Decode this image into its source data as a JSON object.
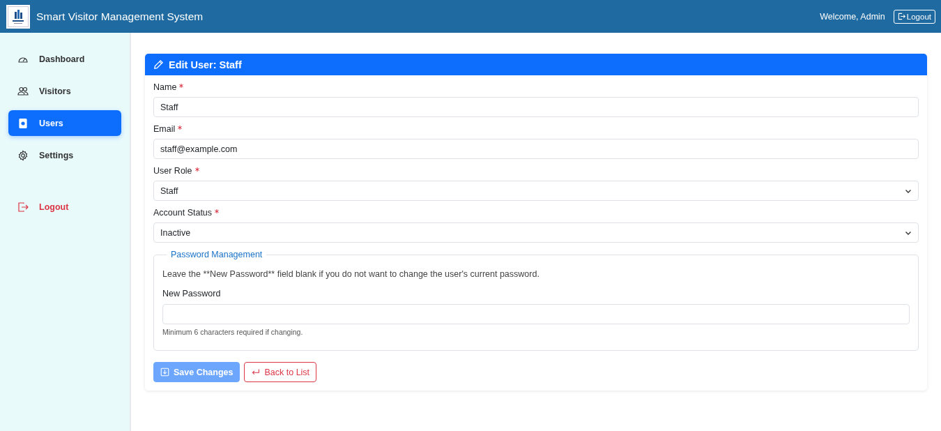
{
  "header": {
    "title": "Smart Visitor Management System",
    "welcome": "Welcome, Admin",
    "logout_button": "Logout"
  },
  "sidebar": {
    "items": [
      {
        "label": "Dashboard",
        "selected": false,
        "kind": "nav"
      },
      {
        "label": "Visitors",
        "selected": false,
        "kind": "nav"
      },
      {
        "label": "Users",
        "selected": true,
        "kind": "nav"
      },
      {
        "label": "Settings",
        "selected": false,
        "kind": "nav"
      },
      {
        "label": "Logout",
        "selected": false,
        "kind": "logout"
      }
    ]
  },
  "card": {
    "title": "Edit User: Staff",
    "fields": [
      {
        "label": "Name",
        "required": true,
        "kind": "input",
        "value": "Staff"
      },
      {
        "label": "Email",
        "required": true,
        "kind": "input",
        "value": "staff@example.com"
      },
      {
        "label": "User Role",
        "required": true,
        "kind": "select",
        "value": "Staff"
      },
      {
        "label": "Account Status",
        "required": true,
        "kind": "select",
        "value": "Inactive"
      }
    ],
    "password_section": {
      "legend": "Password Management",
      "note": "Leave the **New Password** field blank if you do not want to change the user's current password.",
      "field_label": "New Password",
      "hint": "Minimum 6 characters required if changing."
    },
    "buttons": [
      {
        "label": "Save Changes",
        "kind": "primary",
        "disabled": true
      },
      {
        "label": "Back to List",
        "kind": "outline",
        "disabled": false
      }
    ]
  }
}
